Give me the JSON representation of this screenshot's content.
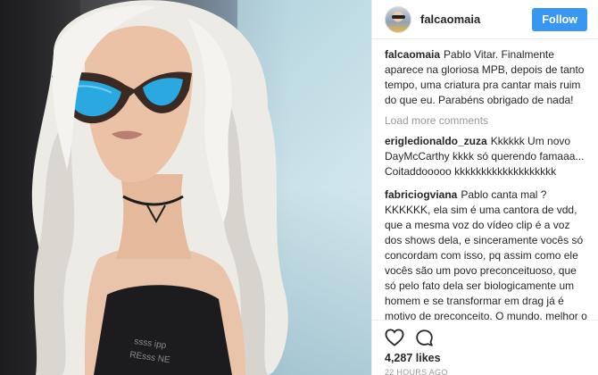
{
  "header": {
    "username": "falcaomaia",
    "follow_label": "Follow"
  },
  "caption": {
    "username": "falcaomaia",
    "text": "Pablo Vitar. Finalmente aparece na gloriosa MPB, depois de tanto tempo, uma criatura pra cantar mais ruim do que eu. Parabéns obrigado de nada!"
  },
  "load_more_label": "Load more comments",
  "comments": [
    {
      "username": "erigledionaldo_zuza",
      "text": "Kkkkkk Um novo DayMcCarthy kkkk só querendo famaaa... Coitaddooooo kkkkkkkkkkkkkkkkkkk"
    },
    {
      "username": "fabriciogviana",
      "text": "Pablo canta mal ? KKKKKK, ela sim é uma cantora de vdd, que a mesma voz do vídeo clip é a voz dos shows dela, e sinceramente vocês só concordam com isso, pq assim como ele vocês são um povo preconceituoso, que só pelo fato dela ser biologicamente um homem e se transformar em drag já é motivo de preconceito. O mundo, melhor o Brasil vem regredindo cada vez mais do que evoluindo, e depois vem um monte de"
    }
  ],
  "likes": "4,287 likes",
  "timestamp": "22 HOURS AGO",
  "icons": [
    "heart-icon",
    "comment-icon"
  ],
  "colors": {
    "follow_button": "#3897f0",
    "text": "#262626",
    "muted": "#999999"
  }
}
